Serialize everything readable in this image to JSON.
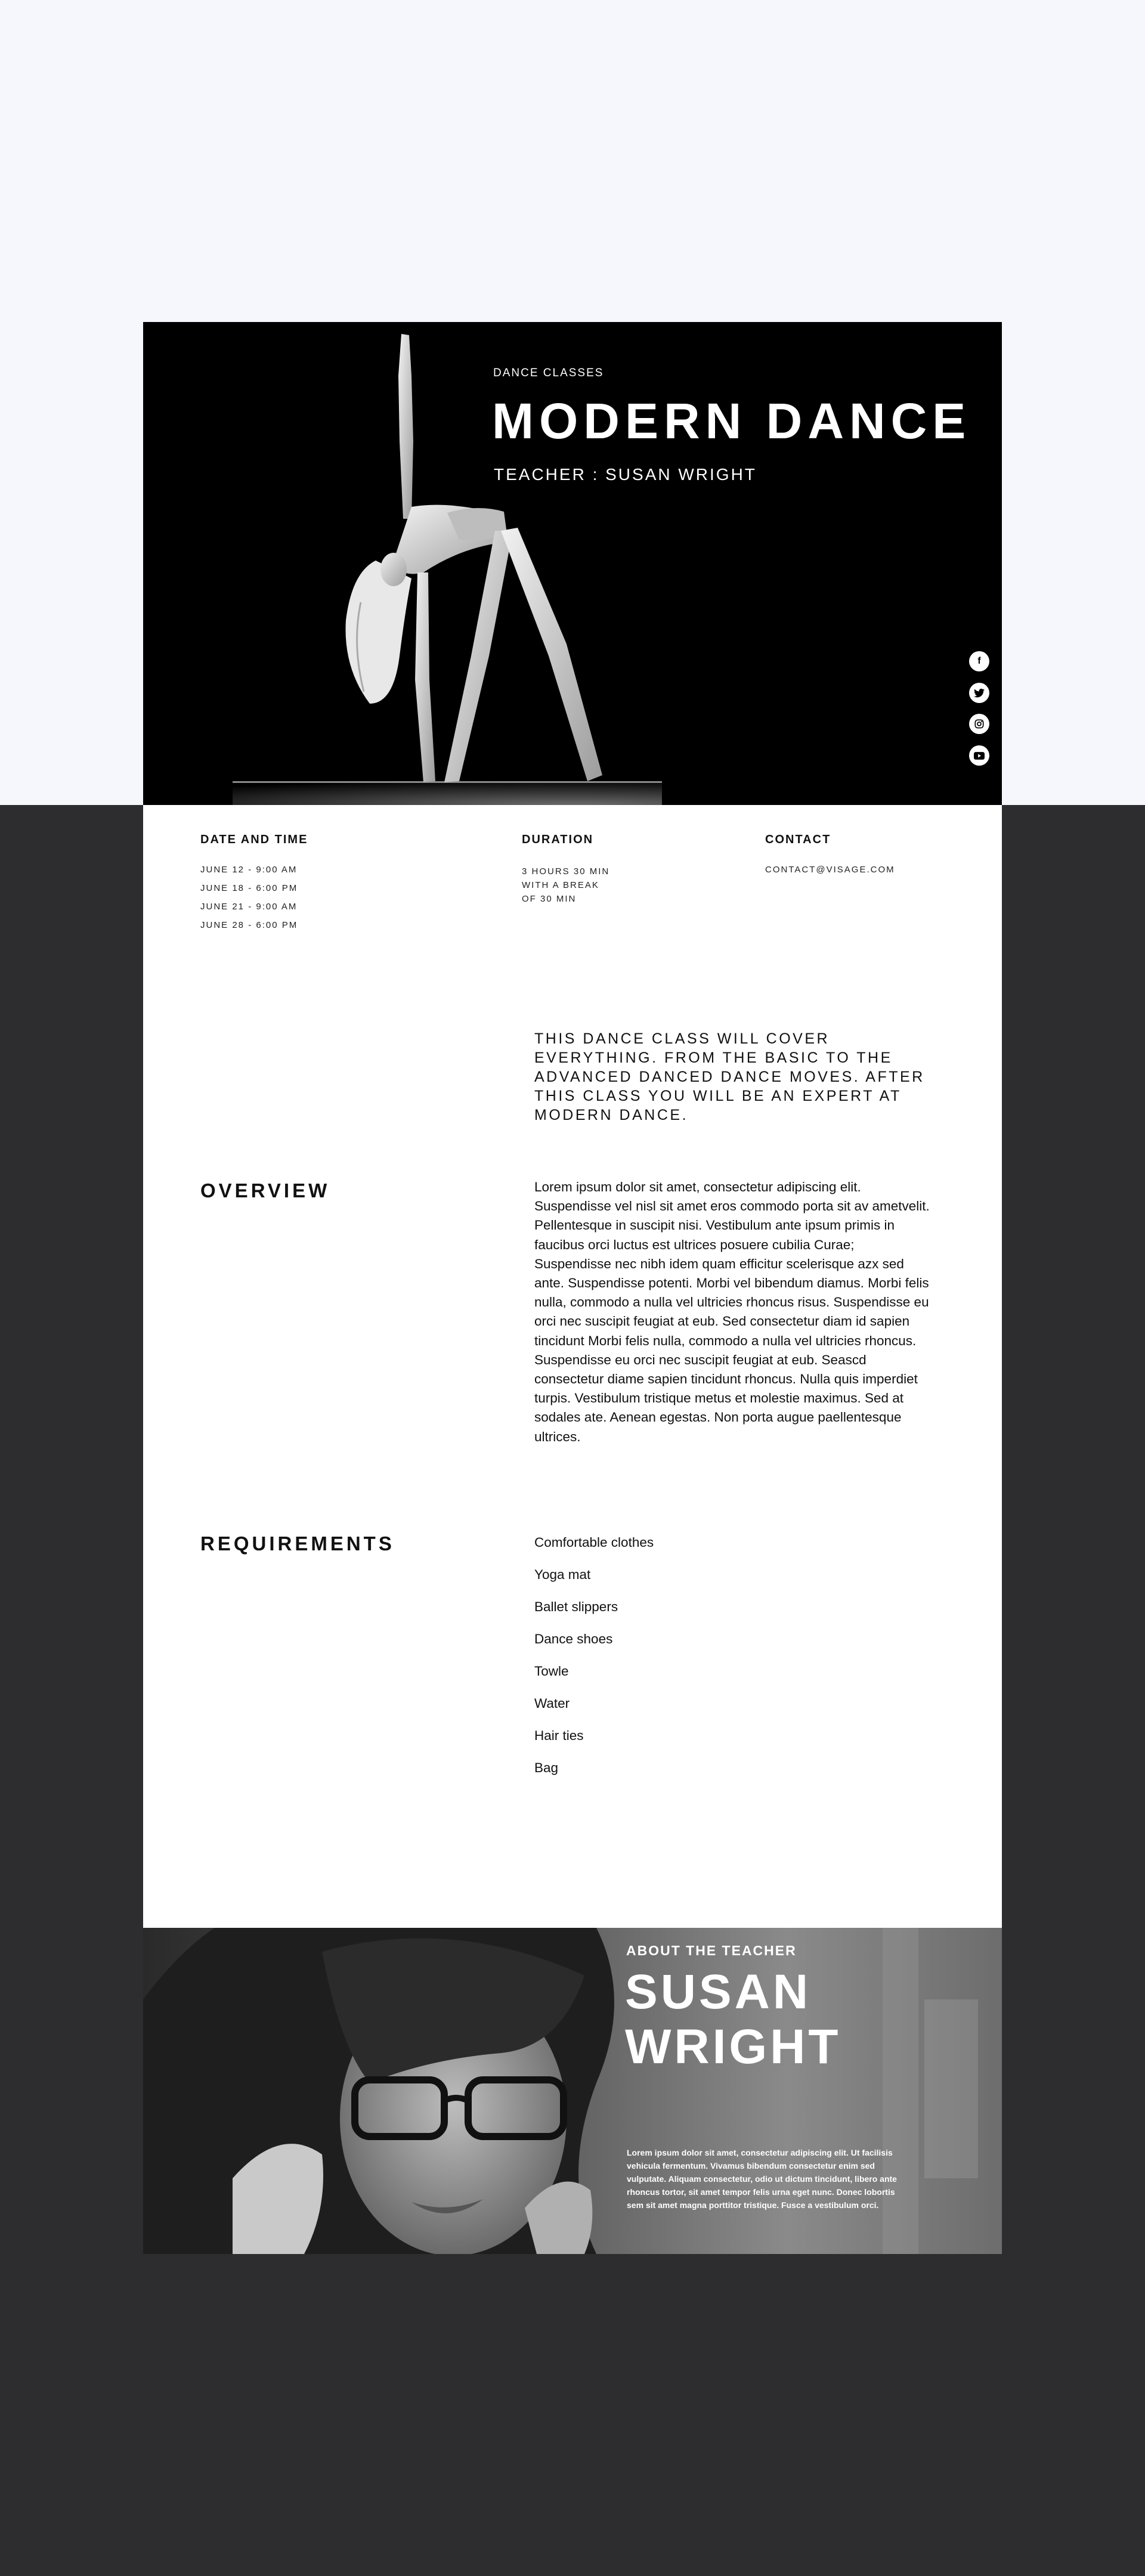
{
  "hero": {
    "eyebrow": "DANCE CLASSES",
    "title": "MODERN DANCE",
    "teacher": "TEACHER : SUSAN WRIGHT",
    "social_icons": [
      "facebook-icon",
      "twitter-icon",
      "instagram-icon",
      "youtube-icon"
    ]
  },
  "info": {
    "date_heading": "DATE AND TIME",
    "dates": [
      "JUNE 12 - 9:00 AM",
      "JUNE 18 - 6:00 PM",
      "JUNE 21 - 9:00 AM",
      "JUNE 28 - 6:00 PM"
    ],
    "duration_heading": "DURATION",
    "duration_lines": [
      "3 HOURS 30 MIN",
      "WITH A BREAK",
      "OF 30 MIN"
    ],
    "contact_heading": "CONTACT",
    "contact_email": "CONTACT@VISAGE.COM"
  },
  "intro": "THIS DANCE CLASS WILL COVER EVERYTHING. FROM THE BASIC TO THE ADVANCED DANCED DANCE MOVES. AFTER THIS CLASS YOU WILL BE AN EXPERT AT MODERN DANCE.",
  "overview": {
    "heading": "OVERVIEW",
    "text": "Lorem ipsum dolor sit amet, consectetur adipiscing elit. Suspendisse vel nisl sit amet eros commodo porta sit av ametvelit. Pellentesque in suscipit nisi. Vestibulum ante ipsum primis in faucibus orci luctus est ultrices posuere cubilia Curae; Suspendisse nec nibh idem quam efficitur scelerisque azx sed ante. Suspendisse potenti. Morbi vel bibendum diamus. Morbi felis nulla, commodo a nulla vel ultricies rhoncus risus. Suspendisse eu orci nec suscipit feugiat at eub. Sed consectetur diam id sapien tincidunt Morbi felis nulla, commodo a nulla vel ultricies rhoncus. Suspendisse eu orci nec suscipit feugiat at eub. Seascd consectetur diame sapien tincidunt rhoncus. Nulla quis imperdiet turpis. Vestibulum tristique metus et molestie maximus. Sed at sodales ate. Aenean egestas. Non porta augue paellentesque ultrices."
  },
  "requirements": {
    "heading": "REQUIREMENTS",
    "items": [
      "Comfortable clothes",
      "Yoga mat",
      "Ballet slippers",
      "Dance shoes",
      "Towle",
      "Water",
      "Hair ties",
      "Bag"
    ]
  },
  "about": {
    "eyebrow": "ABOUT THE TEACHER",
    "name_line1": "SUSAN",
    "name_line2": "WRIGHT",
    "bio": "Lorem ipsum dolor sit amet, consectetur adipiscing elit. Ut facilisis vehicula fermentum. Vivamus bibendum consectetur enim sed vulputate. Aliquam consectetur, odio ut dictum tincidunt, libero ante rhoncus tortor, sit amet tempor felis urna eget nunc. Donec lobortis sem sit amet magna porttitor tristique. Fusce a vestibulum orci."
  },
  "colors": {
    "page_top": "#f6f7fd",
    "page_bottom": "#2d2d2f",
    "hero_bg": "#000000",
    "text": "#111111"
  }
}
